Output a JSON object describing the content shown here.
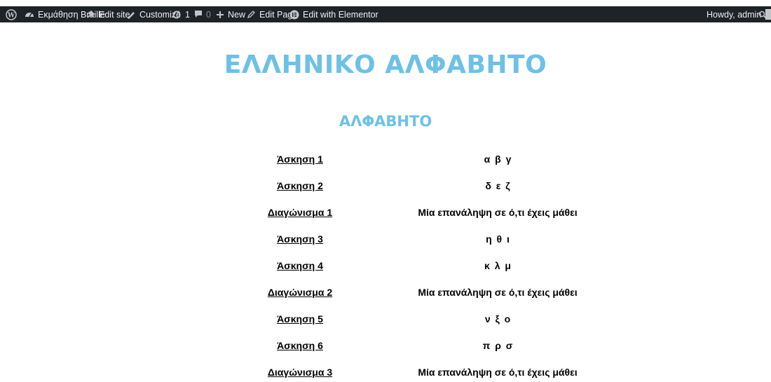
{
  "admin_bar": {
    "site_name": "Εκμάθηση Braille",
    "edit_site": "Edit site",
    "customize": "Customize",
    "updates_count": "1",
    "comments_count": "0",
    "new": "New",
    "edit_page": "Edit Page",
    "edit_with_elementor": "Edit with Elementor",
    "howdy": "Howdy, admin"
  },
  "page": {
    "title": "ΕΛΛΗΝΙΚΟ ΑΛΦΑΒΗΤΟ",
    "section_heading": "ΑΛΦΑΒΗΤΟ"
  },
  "lessons": [
    {
      "link": "Άσκηση 1",
      "description": "α β γ"
    },
    {
      "link": "Άσκηση 2",
      "description": "δ ε ζ"
    },
    {
      "link": "Διαγώνισμα 1",
      "description": "Μία επανάληψη σε ό,τι έχεις μάθει"
    },
    {
      "link": "Άσκηση 3",
      "description": "η θ ι"
    },
    {
      "link": "Άσκηση 4",
      "description": "κ λ μ"
    },
    {
      "link": "Διαγώνισμα 2",
      "description": "Μία επανάληψη σε ό,τι έχεις μάθει"
    },
    {
      "link": "Άσκηση 5",
      "description": "ν ξ ο"
    },
    {
      "link": "Άσκηση 6",
      "description": "π ρ σ"
    },
    {
      "link": "Διαγώνισμα 3",
      "description": "Μία επανάληψη σε ό,τι έχεις μάθει"
    }
  ]
}
